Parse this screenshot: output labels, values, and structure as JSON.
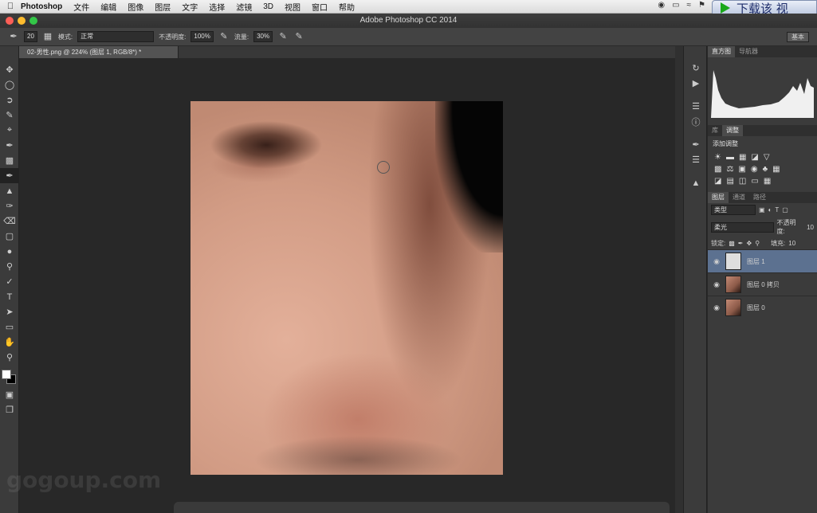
{
  "menubar": {
    "app_name": "Photoshop",
    "items": [
      "文件",
      "编辑",
      "图像",
      "图层",
      "文字",
      "选择",
      "滤镜",
      "3D",
      "视图",
      "窗口",
      "帮助"
    ]
  },
  "download_banner": {
    "text": "下载该 视"
  },
  "window": {
    "title": "Adobe Photoshop CC 2014"
  },
  "options": {
    "brush_size": "20",
    "mode_label": "模式:",
    "mode_value": "正常",
    "opacity_label": "不透明度:",
    "opacity_value": "100%",
    "flow_label": "流量:",
    "flow_value": "30%",
    "right_button": "基本"
  },
  "document": {
    "tab_title": "02-男性.png @ 224% (图层 1, RGB/8*) *"
  },
  "watermark": "gogoup.com",
  "panels": {
    "top_tabs": [
      "直方图",
      "导航器"
    ],
    "mid_tabs": [
      "库",
      "调整"
    ],
    "adjust_title": "添加调整",
    "layer_tabs": [
      "图层",
      "通道",
      "路径"
    ],
    "kind_label": "类型",
    "blend_mode": "柔光",
    "opacity_label": "不透明度:",
    "opacity_value": "10",
    "lock_label": "锁定:",
    "fill_label": "填充:",
    "fill_value": "10",
    "layers": [
      {
        "name": "图层 1"
      },
      {
        "name": "图层 0 拷贝"
      },
      {
        "name": "图层 0"
      }
    ]
  },
  "colors": {
    "selected_layer": "#5c7190",
    "panel_bg": "#3b3b3b"
  }
}
